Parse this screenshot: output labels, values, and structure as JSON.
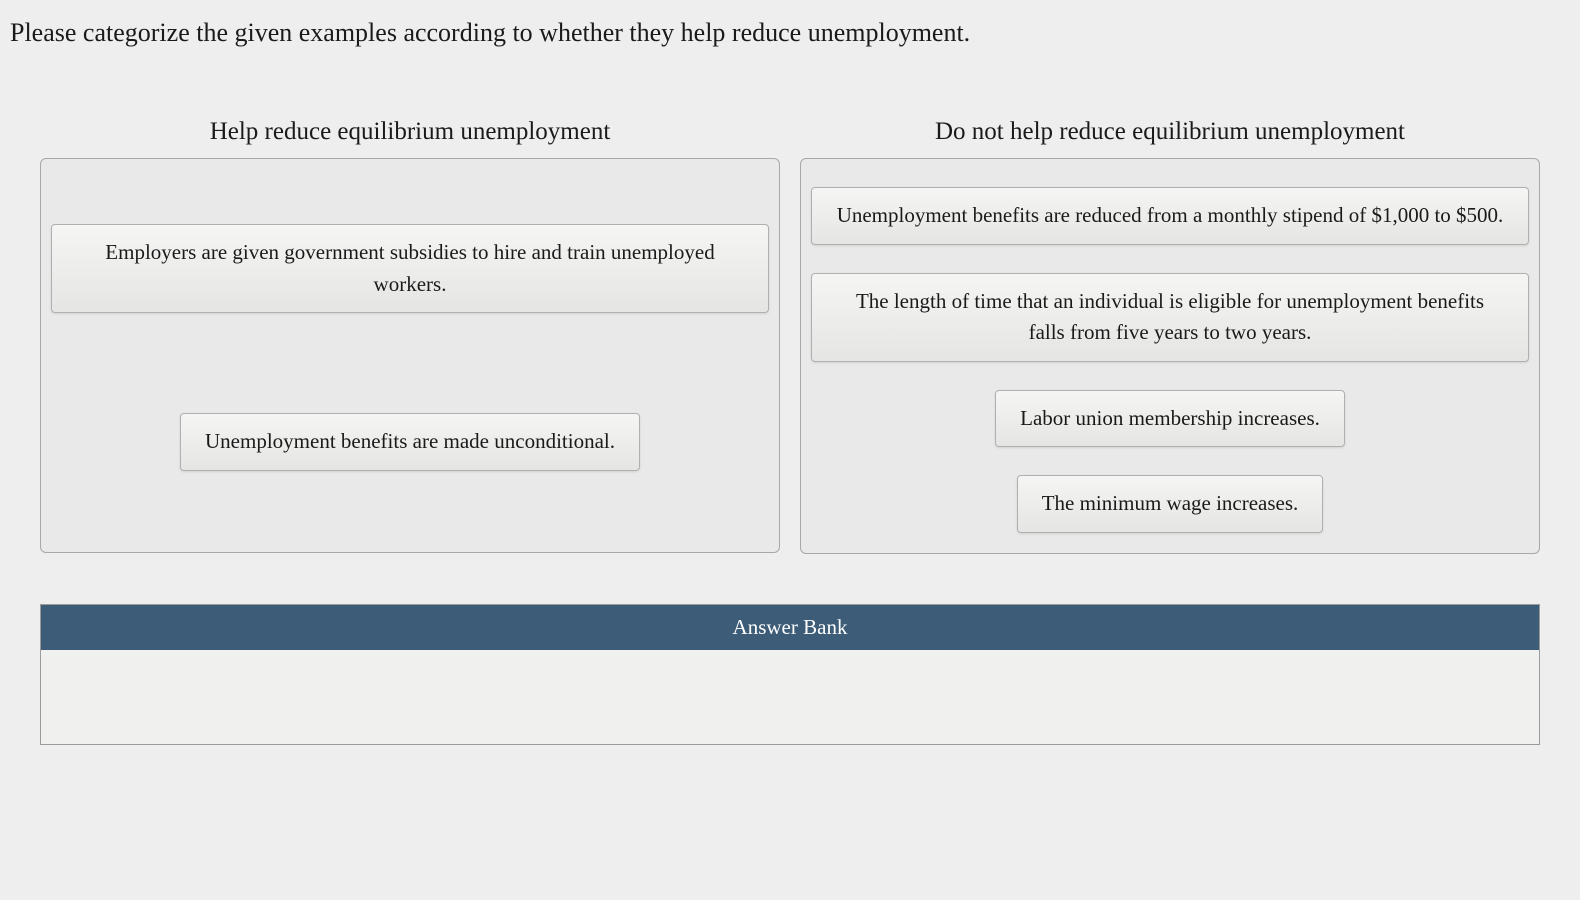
{
  "question": "Please categorize the given examples according to whether they help reduce unemployment.",
  "categories": {
    "left": {
      "header": "Help reduce equilibrium unemployment",
      "items": [
        "Employers are given government subsidies to hire and train unemployed workers.",
        "Unemployment benefits are made unconditional."
      ]
    },
    "right": {
      "header": "Do not help reduce equilibrium unemployment",
      "items": [
        "Unemployment benefits are reduced from a monthly stipend of $1,000 to $500.",
        "The length of time that an individual is eligible for unemployment benefits falls from five years to two years.",
        "Labor union membership increases.",
        "The minimum wage increases."
      ]
    }
  },
  "answerBank": {
    "header": "Answer Bank"
  }
}
